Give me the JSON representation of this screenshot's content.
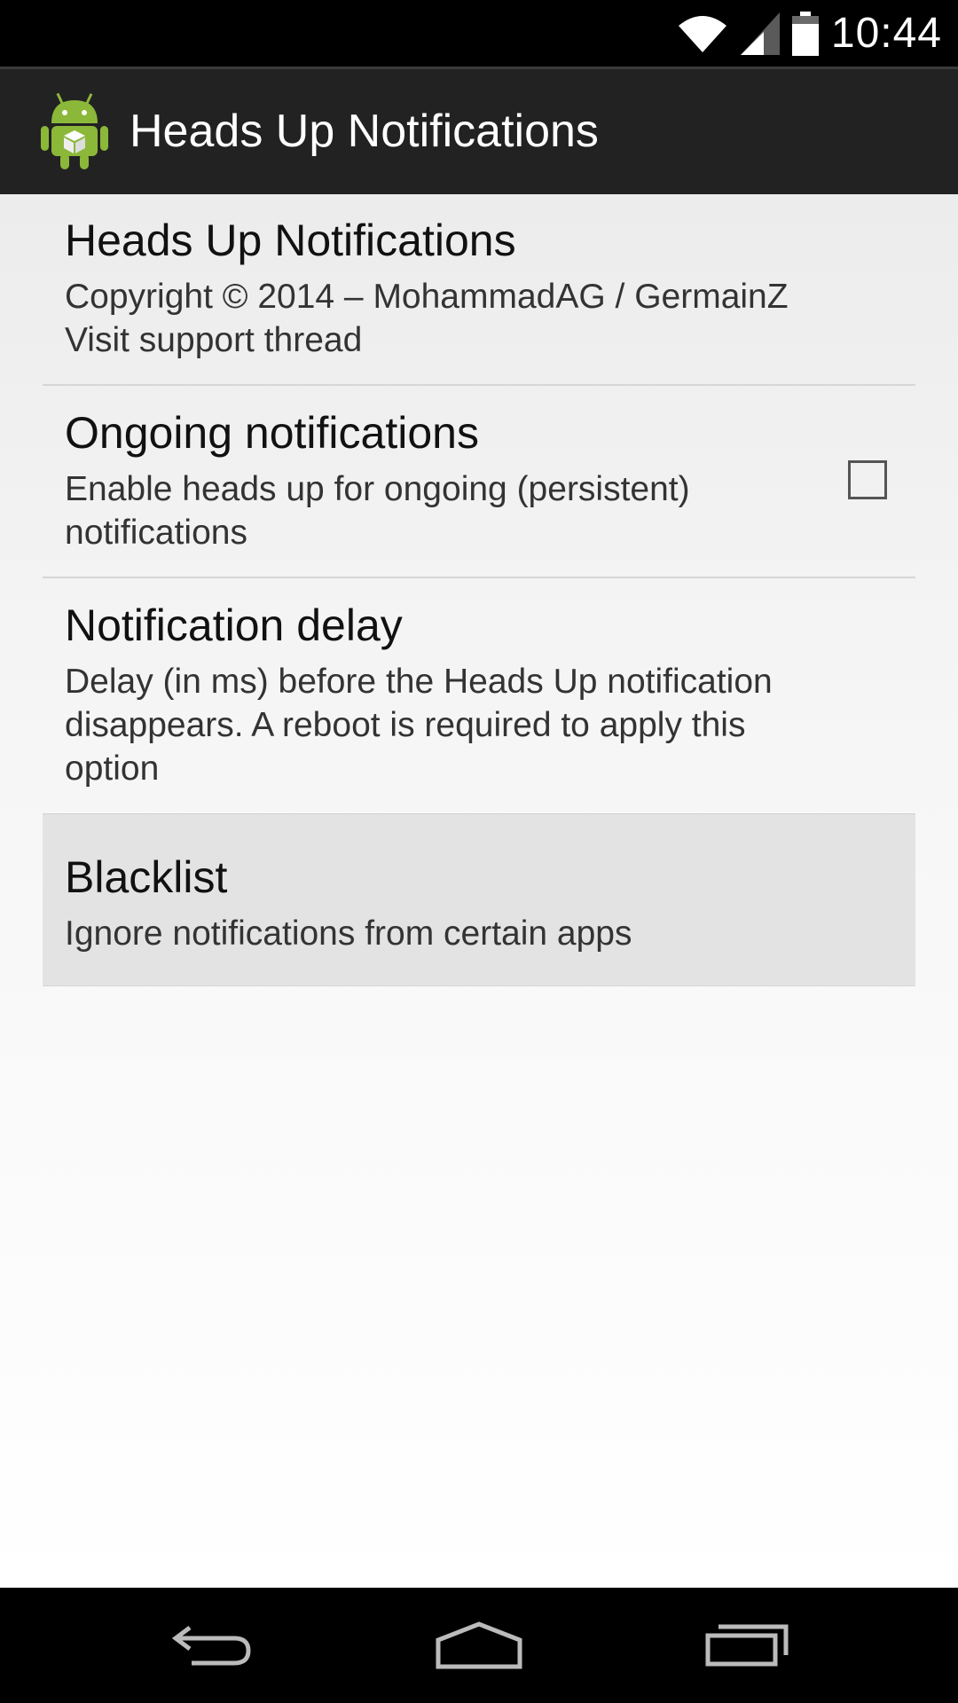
{
  "status_bar": {
    "time": "10:44"
  },
  "action_bar": {
    "title": "Heads Up Notifications",
    "icon": "android-app-icon"
  },
  "preferences": [
    {
      "title": "Heads Up Notifications",
      "summary_lines": [
        "Copyright © 2014 – MohammadAG / GermainZ",
        "Visit support thread"
      ]
    },
    {
      "title": "Ongoing notifications",
      "summary_lines": [
        "Enable heads up for ongoing (persistent)",
        "notifications"
      ],
      "checked": false
    },
    {
      "title": "Notification delay",
      "summary_lines": [
        "Delay (in ms) before the Heads Up notification",
        "disappears. A reboot is required to apply this",
        "option"
      ]
    },
    {
      "title": "Blacklist",
      "summary_lines": [
        "Ignore notifications from certain apps"
      ]
    }
  ],
  "nav_bar": {
    "icons": [
      "back-icon",
      "home-icon",
      "recent-apps-icon"
    ]
  },
  "colors": {
    "action_bar": "#222222",
    "pressed_item": "#e3e3e3",
    "icon_green": "#8cb83a"
  }
}
